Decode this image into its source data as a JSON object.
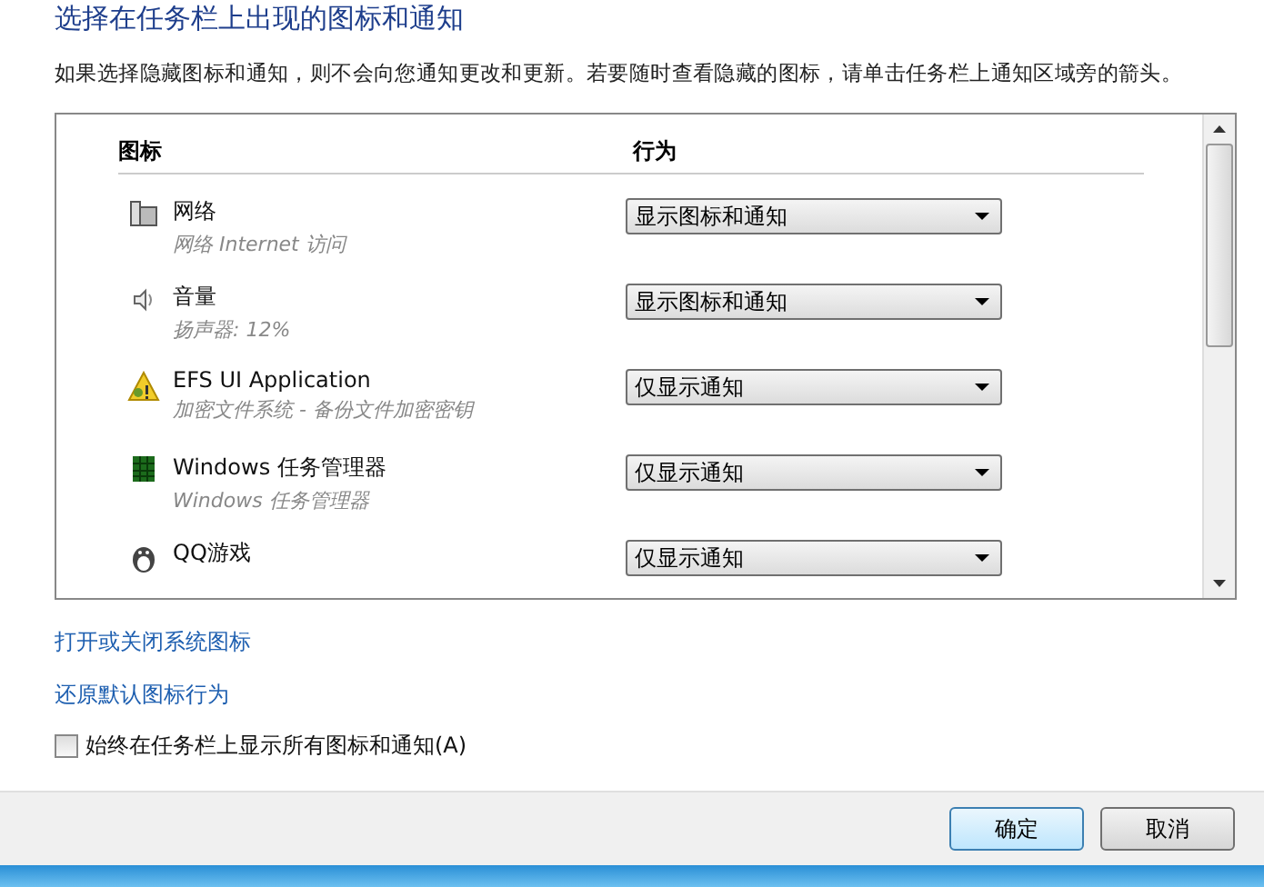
{
  "title": "选择在任务栏上出现的图标和通知",
  "description": "如果选择隐藏图标和通知，则不会向您通知更改和更新。若要随时查看隐藏的图标，请单击任务栏上通知区域旁的箭头。",
  "table": {
    "columns": [
      "图标",
      "行为"
    ],
    "rows": [
      {
        "kind": "network",
        "name": "网络",
        "detail": "网络 Internet 访问",
        "behavior": "显示图标和通知"
      },
      {
        "kind": "volume",
        "name": "音量",
        "detail": "扬声器: 12%",
        "behavior": "显示图标和通知"
      },
      {
        "kind": "key",
        "name": "EFS UI Application",
        "detail": "加密文件系统 - 备份文件加密密钥",
        "behavior": "仅显示通知"
      },
      {
        "kind": "taskmgr",
        "name": "Windows 任务管理器",
        "detail": "Windows 任务管理器",
        "behavior": "仅显示通知"
      },
      {
        "kind": "game",
        "name": "QQ游戏",
        "behavior": "仅显示通知"
      }
    ]
  },
  "links": [
    "打开或关闭系统图标",
    "还原默认图标行为"
  ],
  "always_show": {
    "label": "始终在任务栏上显示所有图标和通知(A)",
    "checked": false
  },
  "buttons": [
    {
      "label": "确定",
      "selected": true
    },
    {
      "label": "取消",
      "selected": false
    }
  ]
}
